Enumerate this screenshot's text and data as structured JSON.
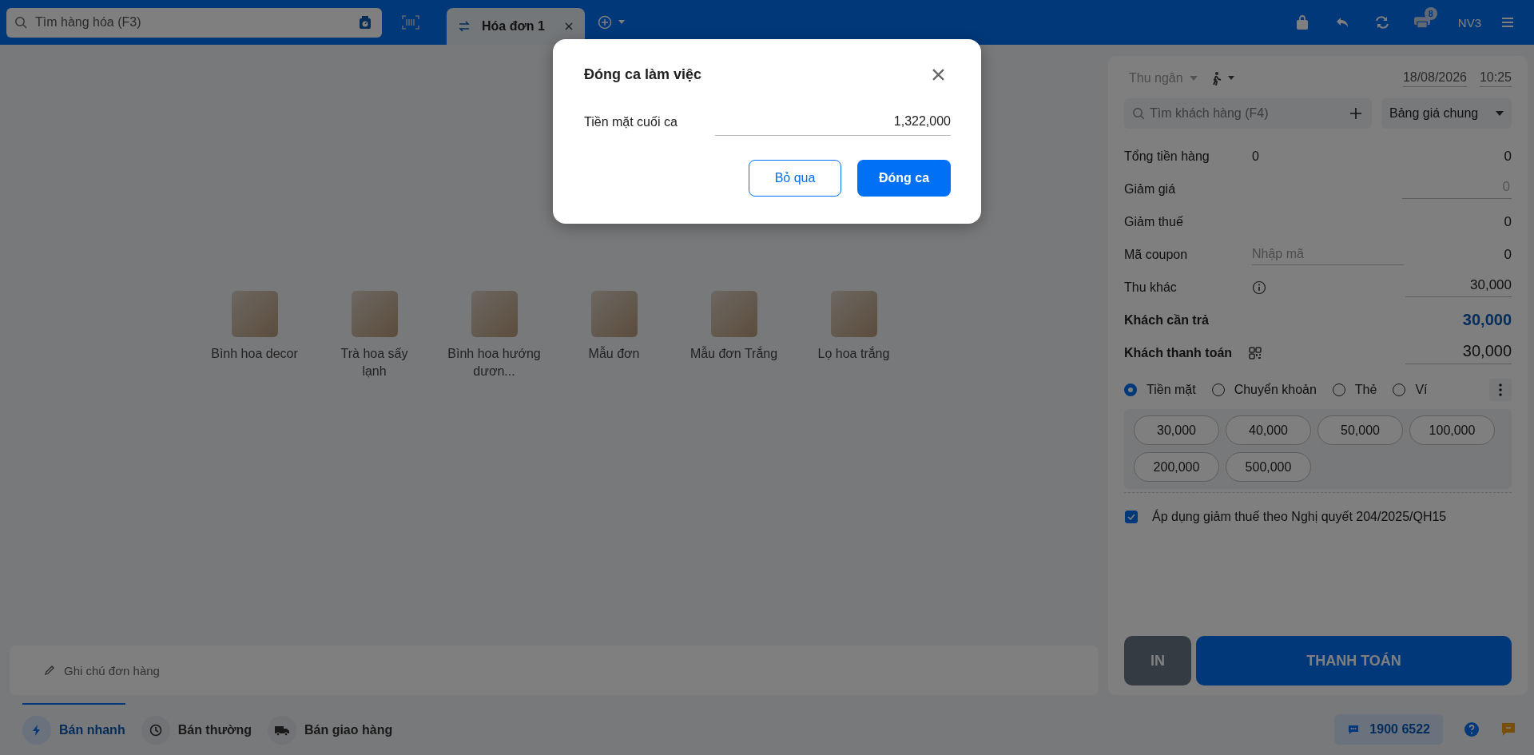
{
  "top_bar": {
    "product_search": {
      "placeholder": "Tìm hàng hóa (F3)"
    },
    "tabs": [
      {
        "label": "Hóa đơn 1",
        "selected": true
      }
    ],
    "printer_badge": "8",
    "user": "NV3"
  },
  "products": [
    {
      "name": "Bình hoa decor"
    },
    {
      "name": "Trà hoa sấy lạnh"
    },
    {
      "name": "Bình hoa hướng dươn..."
    },
    {
      "name": "Mẫu đơn"
    },
    {
      "name": "Mẫu đơn Trắng"
    },
    {
      "name": "Lọ hoa trắng"
    }
  ],
  "order_note": {
    "placeholder": "Ghi chú đơn hàng"
  },
  "checkout": {
    "cashier": "Thu ngân",
    "date": "18/08/2026",
    "time": "10:25",
    "customer_search": {
      "placeholder": "Tìm khách hàng (F4)"
    },
    "price_list": "Bảng giá chung",
    "summary": [
      {
        "kind": "plain",
        "label": "Tổng tiền hàng",
        "count": "0",
        "value": "0"
      },
      {
        "kind": "input",
        "label": "Giảm giá",
        "placeholder": "0"
      },
      {
        "kind": "plain",
        "label": "Giảm thuế",
        "value": "0"
      },
      {
        "kind": "coupon",
        "label": "Mã coupon",
        "placeholder": "Nhập mã",
        "value": "0"
      },
      {
        "kind": "info-input",
        "label": "Thu khác",
        "value": "30,000"
      },
      {
        "kind": "due",
        "label": "Khách cần trả",
        "value": "30,000"
      },
      {
        "kind": "paid",
        "label": "Khách thanh toán",
        "value": "30,000"
      }
    ],
    "payment_methods": [
      {
        "label": "Tiền mặt",
        "selected": true
      },
      {
        "label": "Chuyển khoản",
        "selected": false
      },
      {
        "label": "Thẻ",
        "selected": false
      },
      {
        "label": "Ví",
        "selected": false
      }
    ],
    "quick_amounts": [
      "30,000",
      "40,000",
      "50,000",
      "100,000",
      "200,000",
      "500,000"
    ],
    "tax_reduction": {
      "label": "Áp dụng giảm thuế theo Nghị quyết 204/2025/QH15",
      "checked": true
    },
    "print_button": "IN",
    "pay_button": "THANH TOÁN"
  },
  "bottom_bar": {
    "modes": [
      {
        "label": "Bán nhanh",
        "selected": true
      },
      {
        "label": "Bán thường",
        "selected": false
      },
      {
        "label": "Bán giao hàng",
        "selected": false
      }
    ],
    "hotline": "1900 6522"
  },
  "dialog": {
    "title": "Đóng ca làm việc",
    "field_label": "Tiền mặt cuối ca",
    "field_value": "1,322,000",
    "cancel_button": "Bỏ qua",
    "confirm_button": "Đóng ca"
  }
}
